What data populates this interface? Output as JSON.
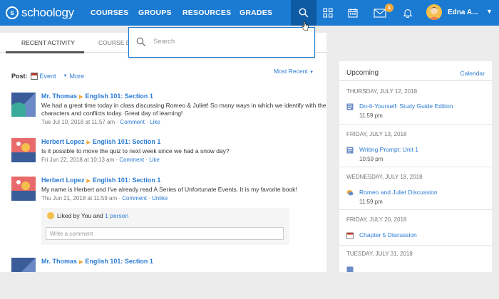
{
  "app": {
    "logo_text": "schoology",
    "logo_mark": "s"
  },
  "nav": {
    "links": [
      "COURSES",
      "GROUPS",
      "RESOURCES",
      "GRADES"
    ],
    "message_badge": "1",
    "user_name": "Edna A...",
    "icons": [
      "search-icon",
      "apps-grid-icon",
      "calendar-icon",
      "mail-icon",
      "bell-icon",
      "chevron-down-icon"
    ],
    "brand_color": "#1b7ad1"
  },
  "search": {
    "placeholder": "Search"
  },
  "tabs": {
    "recent_activity": "RECENT ACTIVITY",
    "course_dashboard": "COURSE DA"
  },
  "post": {
    "label": "Post:",
    "event": "Event",
    "more": "More",
    "sort": "Most Recent"
  },
  "feed": [
    {
      "author": "Mr. Thomas",
      "course": "English 101: Section 1",
      "text": "We had a great time today in class discussing Romeo & Juliet! So many ways in which we identify with the characters and conflicts today. Great day of learning!",
      "timestamp": "Tue Jul 10, 2018 at 11:57 am",
      "action_comment": "Comment",
      "action_like": "Like"
    },
    {
      "author": "Herbert Lopez",
      "course": "English 101: Section 1",
      "text": "Is it possible to move the quiz to next week since we had a snow day?",
      "timestamp": "Fri Jun 22, 2018 at 10:13 am",
      "action_comment": "Comment",
      "action_like": "Like"
    },
    {
      "author": "Herbert Lopez",
      "course": "English 101: Section 1",
      "text": "My name is Herbert and I've already read A Series of Unfortunate Events. It is my favorite book!",
      "timestamp": "Thu Jun 21, 2018 at 11:59 am",
      "action_comment": "Comment",
      "action_like": "Unlike"
    },
    {
      "author": "Mr. Thomas",
      "course": "English 101: Section 1",
      "text": "",
      "timestamp": "",
      "action_comment": "",
      "action_like": ""
    }
  ],
  "likes": {
    "text": "Liked by You and",
    "link": "1 person",
    "comment_placeholder": "Write a comment"
  },
  "upcoming": {
    "title": "Upcoming",
    "calendar_link": "Calendar",
    "days": [
      {
        "date": "THURSDAY, JULY 12, 2018",
        "event": "Do-It-Yourself: Study Guide Edition",
        "time": "11:59 pm",
        "icon": "assignment-icon"
      },
      {
        "date": "FRIDAY, JULY 13, 2018",
        "event": "Writing Prompt: Unit 1",
        "time": "10:59 pm",
        "icon": "assignment-icon"
      },
      {
        "date": "WEDNESDAY, JULY 18, 2018",
        "event": "Romeo and Juliet Discussion",
        "time": "11:59 pm",
        "icon": "discussion-icon"
      },
      {
        "date": "FRIDAY, JULY 20, 2018",
        "event": "Chapter 5 Discussion",
        "time": "",
        "icon": "event-icon"
      },
      {
        "date": "TUESDAY, JULY 31, 2018",
        "event": "",
        "time": "",
        "icon": "assignment-icon"
      }
    ]
  }
}
